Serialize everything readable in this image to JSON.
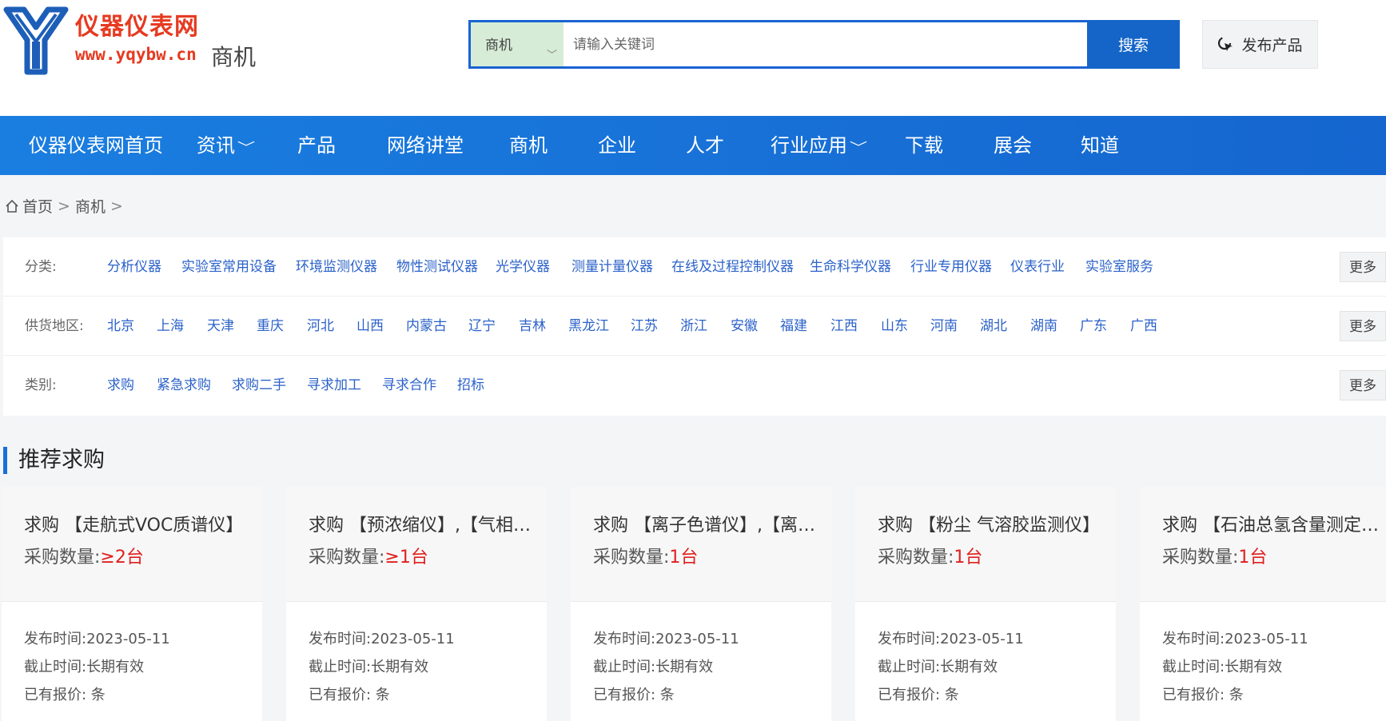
{
  "logo": {
    "title": "仪器仪表网",
    "url": "www.yqybw.cn",
    "subtitle": "商机"
  },
  "search": {
    "select_value": "商机",
    "placeholder": "请输入关键词",
    "button_label": "搜索"
  },
  "publish": {
    "label": "发布产品"
  },
  "nav": [
    {
      "label": "仪器仪表网首页",
      "caret": ""
    },
    {
      "label": "资讯",
      "caret": "﹀"
    },
    {
      "label": "产品",
      "caret": ""
    },
    {
      "label": "网络讲堂",
      "caret": ""
    },
    {
      "label": "商机",
      "caret": ""
    },
    {
      "label": "企业",
      "caret": ""
    },
    {
      "label": "人才",
      "caret": ""
    },
    {
      "label": "行业应用",
      "caret": "﹀"
    },
    {
      "label": "下载",
      "caret": ""
    },
    {
      "label": "展会",
      "caret": ""
    },
    {
      "label": "知道",
      "caret": ""
    }
  ],
  "breadcrumb": {
    "home": "首页",
    "current": "商机",
    "sep": ">"
  },
  "filters": [
    {
      "label": "分类:",
      "items": [
        "分析仪器",
        "实验室常用设备",
        "环境监测仪器",
        "物性测试仪器",
        "光学仪器",
        "测量计量仪器",
        "在线及过程控制仪器",
        "生命科学仪器",
        "行业专用仪器",
        "仪表行业",
        "实验室服务"
      ],
      "more": "更多"
    },
    {
      "label": "供货地区:",
      "items": [
        "北京",
        "上海",
        "天津",
        "重庆",
        "河北",
        "山西",
        "内蒙古",
        "辽宁",
        "吉林",
        "黑龙江",
        "江苏",
        "浙江",
        "安徽",
        "福建",
        "江西",
        "山东",
        "河南",
        "湖北",
        "湖南",
        "广东",
        "广西"
      ],
      "more": "更多"
    },
    {
      "label": "类别:",
      "items": [
        "求购",
        "紧急求购",
        "求购二手",
        "寻求加工",
        "寻求合作",
        "招标"
      ],
      "more": "更多"
    }
  ],
  "section": {
    "title": "推荐求购"
  },
  "cards": [
    {
      "title": "求购 【走航式VOC质谱仪】",
      "qty_label": "采购数量:",
      "qty_value": "≥2台",
      "publish": "发布时间:2023-05-11",
      "deadline": "截止时间:长期有效",
      "quotes": "已有报价: 条"
    },
    {
      "title": "求购 【预浓缩仪】,【气相色谱】",
      "qty_label": "采购数量:",
      "qty_value": "≥1台",
      "publish": "发布时间:2023-05-11",
      "deadline": "截止时间:长期有效",
      "quotes": "已有报价: 条"
    },
    {
      "title": "求购 【离子色谱仪】,【离子】",
      "qty_label": "采购数量:",
      "qty_value": "1台",
      "publish": "发布时间:2023-05-11",
      "deadline": "截止时间:长期有效",
      "quotes": "已有报价: 条"
    },
    {
      "title": "求购 【粉尘 气溶胶监测仪】",
      "qty_label": "采购数量:",
      "qty_value": "1台",
      "publish": "发布时间:2023-05-11",
      "deadline": "截止时间:长期有效",
      "quotes": "已有报价: 条"
    },
    {
      "title": "求购 【石油总氢含量测定仪】",
      "qty_label": "采购数量:",
      "qty_value": "1台",
      "publish": "发布时间:2023-05-11",
      "deadline": "截止时间:长期有效",
      "quotes": "已有报价: 条"
    }
  ]
}
